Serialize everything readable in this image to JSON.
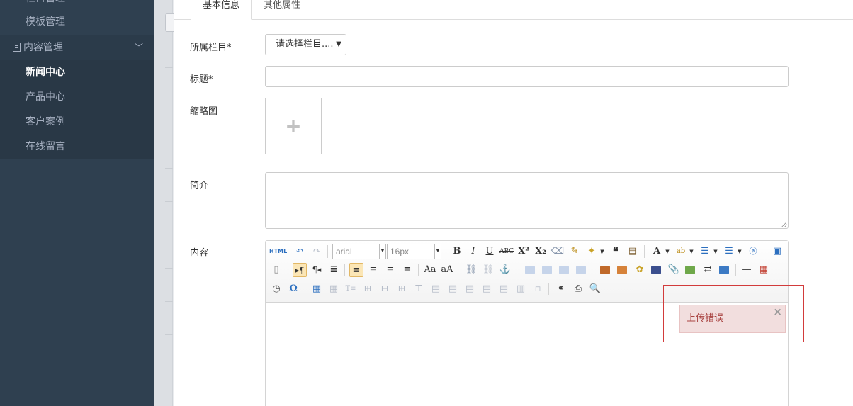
{
  "sidebar": {
    "cut_item": "栏目管理",
    "template_item": "模板管理",
    "section": {
      "label": "内容管理"
    },
    "sub_items": [
      {
        "label": "新闻中心",
        "active": true
      },
      {
        "label": "产品中心",
        "active": false
      },
      {
        "label": "客户案例",
        "active": false
      },
      {
        "label": "在线留言",
        "active": false
      }
    ]
  },
  "tabs": [
    {
      "label": "基本信息",
      "active": true
    },
    {
      "label": "其他属性",
      "active": false
    }
  ],
  "form": {
    "category_label": "所属栏目*",
    "category_placeholder": "请选择栏目....",
    "title_label": "标题*",
    "thumbnail_label": "缩略图",
    "thumbnail_plus": "+",
    "summary_label": "简介",
    "content_label": "内容"
  },
  "editor": {
    "font_family": "arial",
    "font_size": "16px",
    "html_btn": "HTML"
  },
  "error": {
    "message": "上传错误",
    "close": "×"
  },
  "colors": {
    "sidebar_bg": "#2f4050",
    "error_bg": "#f2dede",
    "error_text": "#a94442",
    "frame_red": "#d23b3b"
  }
}
